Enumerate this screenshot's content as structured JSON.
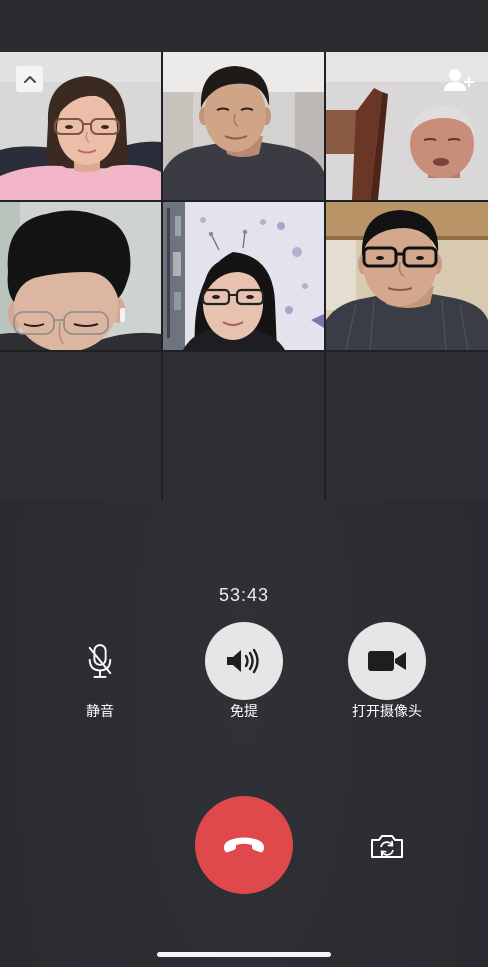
{
  "video_grid": {
    "collapse_button": {
      "icon": "chevron-up-icon"
    },
    "add_member_button": {
      "icon": "add-member-icon"
    }
  },
  "call": {
    "timer": "53:43"
  },
  "controls": {
    "mute": {
      "label": "静音",
      "icon": "mic-off-icon"
    },
    "speaker": {
      "label": "免提",
      "icon": "speaker-icon"
    },
    "camera": {
      "label": "打开摄像头",
      "icon": "video-camera-icon"
    },
    "hangup": {
      "icon": "hangup-icon"
    },
    "switch_camera": {
      "icon": "switch-camera-icon"
    }
  },
  "colors": {
    "background": "#2b2c31",
    "control_button": "#e6e6e6",
    "hangup": "#e0494b",
    "text": "#ffffff"
  }
}
